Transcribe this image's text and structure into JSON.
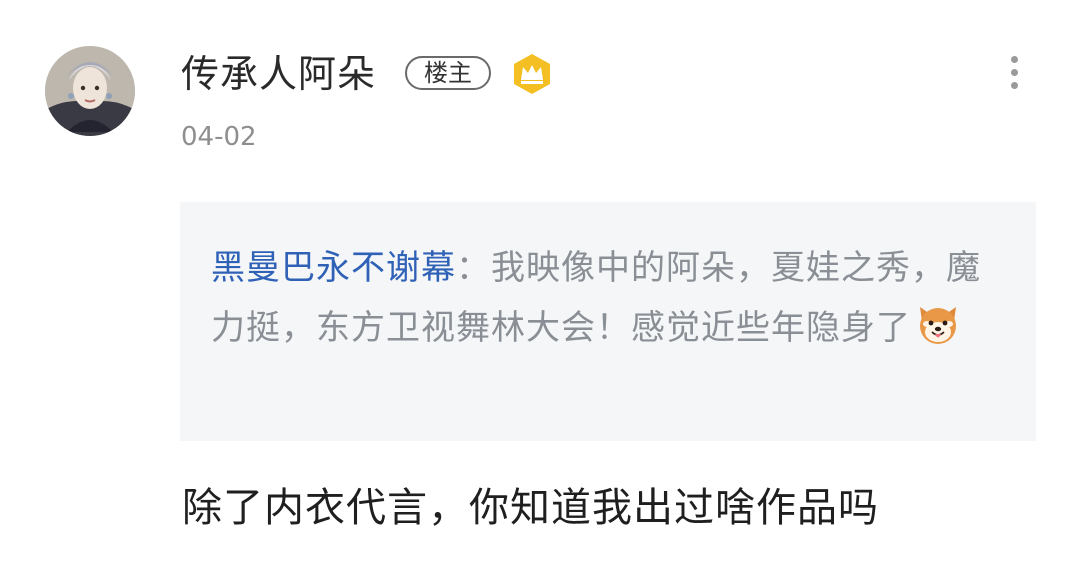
{
  "post": {
    "username": "传承人阿朵",
    "op_badge": "楼主",
    "timestamp": "04-02",
    "avatar_icon": "user-avatar-photo",
    "vip_icon": "crown-icon",
    "menu_icon": "more-vertical-icon"
  },
  "quote": {
    "author": "黑曼巴永不谢幕",
    "colon": "：",
    "text": "我映像中的阿朵，夏娃之秀，魔力挺，东方卫视舞林大会！感觉近些年隐身了",
    "emoji": "dog-face-emoji"
  },
  "reply": {
    "text": "除了内衣代言，你知道我出过啥作品吗"
  },
  "colors": {
    "author_link": "#2f61b7",
    "quote_bg": "#f4f6f8",
    "vip_gold": "#f3bf22",
    "text_primary": "#1f1f1f",
    "text_muted": "#8e8e8e"
  }
}
